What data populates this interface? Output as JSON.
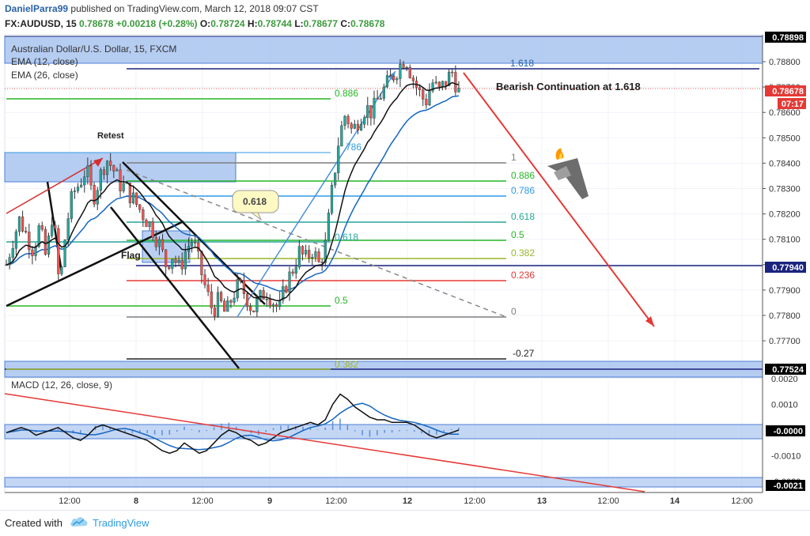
{
  "header": {
    "author": "DanielParra99",
    "published": " published on TradingView.com, March 12, 2018 09:07 CST",
    "symbol": "FX:AUDUSD, 15 ",
    "last": "0.78678",
    "change": "+0.00218 (+0.28%)",
    "ohlc": {
      "o_label": "O:",
      "o": "0.78724",
      "h_label": "H:",
      "h": "0.78744",
      "l_label": "L:",
      "l": "0.78677",
      "c_label": "C:",
      "c": "0.78678"
    }
  },
  "legend": {
    "title": "Australian Dollar/U.S. Dollar, 15, FXCM",
    "ema12": "EMA (12, close)",
    "ema26": "EMA (26, close)",
    "macd": "MACD (12, 26, close, 9)"
  },
  "annotations": {
    "retest": "Retest",
    "flag": "Flag",
    "bearish": "Bearish Continuation at 1.618",
    "bubble": "0.618",
    "fib_upper_1618": "1.618",
    "fib_upper_0886": "0.886",
    "fib_upper_786": "786",
    "fib_upper_0618": "0.618",
    "fib_upper_05": "0.5",
    "fib_upper_0382": "0.382",
    "fib_right": [
      {
        "label": "1",
        "color": "#7f7f7f"
      },
      {
        "label": "0.886",
        "color": "#26b526"
      },
      {
        "label": "0.786",
        "color": "#2e9be6"
      },
      {
        "label": "0.618",
        "color": "#26a69a"
      },
      {
        "label": "0.5",
        "color": "#26b526"
      },
      {
        "label": "0.382",
        "color": "#9bb52a"
      },
      {
        "label": "0.236",
        "color": "#e53935"
      },
      {
        "label": "0",
        "color": "#7f7f7f"
      },
      {
        "label": "-0.27",
        "color": "#222222"
      }
    ]
  },
  "axis": {
    "price_ticks": [
      "0.78800",
      "0.78700",
      "0.78600",
      "0.78500",
      "0.78400",
      "0.78300",
      "0.78200",
      "0.78100",
      "0.78000",
      "0.77900",
      "0.77800",
      "0.77700",
      "0.77600"
    ],
    "macd_ticks": [
      "0.0020",
      "0.0010",
      "0.0000",
      "-0.0010",
      "-0.0020"
    ],
    "time_ticks": [
      "12:00",
      "8",
      "12:00",
      "9",
      "12:00",
      "12",
      "12:00",
      "13",
      "12:00",
      "14",
      "12:00"
    ],
    "price_badges": [
      {
        "text": "0.78898",
        "bg": "#000000",
        "fg": "#ffffff"
      },
      {
        "text": "0.78678",
        "bg": "#e53935",
        "fg": "#ffffff"
      },
      {
        "text": "07:17",
        "bg": "#e53935",
        "fg": "#ffffff"
      },
      {
        "text": "0.77940",
        "bg": "#1a237e",
        "fg": "#ffffff"
      },
      {
        "text": "0.77524",
        "bg": "#000000",
        "fg": "#ffffff"
      }
    ],
    "macd_badges": [
      {
        "text": "-0.0000",
        "bg": "#000000",
        "fg": "#ffffff"
      },
      {
        "text": "-0.0021",
        "bg": "#000000",
        "fg": "#ffffff"
      }
    ]
  },
  "colors": {
    "accent_blue": "#2962ff",
    "band": "#a9c4f0",
    "bull": "#26a69a",
    "bear": "#ef5350",
    "arrow": "#e53935"
  },
  "footer": {
    "created": "Created with",
    "brand": "TradingView"
  },
  "chart_data": {
    "type": "candlestick",
    "symbol": "FX:AUDUSD",
    "interval": "15",
    "ylim": [
      0.7752,
      0.7891
    ],
    "x_ticks": [
      "12:00",
      "8",
      "12:00",
      "9",
      "12:00",
      "12",
      "12:00",
      "13",
      "12:00",
      "14",
      "12:00"
    ],
    "close_path": [
      0.78,
      0.781,
      0.7818,
      0.7812,
      0.7806,
      0.7815,
      0.7802,
      0.7822,
      0.779,
      0.7815,
      0.7828,
      0.7832,
      0.7838,
      0.7826,
      0.7834,
      0.7842,
      0.7838,
      0.7832,
      0.783,
      0.7826,
      0.7822,
      0.7818,
      0.7814,
      0.7808,
      0.78,
      0.7804,
      0.7798,
      0.7806,
      0.781,
      0.78,
      0.779,
      0.7782,
      0.7786,
      0.778,
      0.7788,
      0.7792,
      0.7788,
      0.7782,
      0.7786,
      0.779,
      0.7786,
      0.7782,
      0.7792,
      0.7798,
      0.7805,
      0.7802,
      0.7806,
      0.78,
      0.7808,
      0.783,
      0.785,
      0.786,
      0.7852,
      0.7858,
      0.7862,
      0.786,
      0.7866,
      0.787,
      0.7874,
      0.7878,
      0.7882,
      0.7874,
      0.7868,
      0.7864,
      0.7872,
      0.7868,
      0.7872,
      0.7876,
      0.7868
    ],
    "ema12": "EMA (12, close)",
    "ema26": "EMA (26, close)",
    "last_price": 0.78678,
    "range_marks": [
      0.78898,
      0.7794,
      0.77524
    ],
    "fibonacci_right": [
      {
        "level": "1",
        "price": 0.78373
      },
      {
        "level": "0.886",
        "price": 0.78295
      },
      {
        "level": "0.786",
        "price": 0.78232
      },
      {
        "level": "0.618",
        "price": 0.78122
      },
      {
        "level": "0.5",
        "price": 0.78046
      },
      {
        "level": "0.382",
        "price": 0.7797
      },
      {
        "level": "0.236",
        "price": 0.77877
      },
      {
        "level": "0",
        "price": 0.77724
      },
      {
        "level": "-0.27",
        "price": 0.77551
      }
    ],
    "fibonacci_upper": [
      {
        "level": "1.618",
        "price": 0.7879
      },
      {
        "level": "0.886",
        "price": 0.78679
      },
      {
        "level": "786",
        "price": 0.7847
      },
      {
        "level": "0.618",
        "price": 0.7804
      },
      {
        "level": "0.5",
        "price": 0.7778
      }
    ],
    "macd": {
      "label": "MACD (12, 26, close, 9)",
      "ylim": [
        -0.0022,
        0.0023
      ],
      "ticks": [
        0.002,
        0.001,
        0.0,
        -0.001,
        -0.002
      ],
      "last": -0.0,
      "lower_mark": -0.0021,
      "macd_path": [
        -0.0001,
        0.0,
        0.0001,
        0.0,
        -0.0002,
        -0.0001,
        0.0,
        0.0001,
        -0.0001,
        -0.0003,
        -0.0004,
        -0.0002,
        0.0001,
        0.0002,
        0.0001,
        0.0,
        -0.0001,
        -0.0002,
        -0.0003,
        -0.0004,
        -0.0006,
        -0.0008,
        -0.0009,
        -0.0008,
        -0.0005,
        -0.0007,
        -0.0009,
        -0.0008,
        -0.0005,
        -0.0002,
        0.0,
        -0.0001,
        -0.0003,
        -0.0004,
        -0.0006,
        -0.0005,
        -0.0003,
        -0.0001,
        0.0,
        0.0001,
        0.0002,
        0.0003,
        0.0002,
        0.0004,
        0.001,
        0.0014,
        0.0012,
        0.0009,
        0.0007,
        0.0005,
        0.0004,
        0.0004,
        0.0003,
        0.0003,
        0.0003,
        0.0002,
        0.0,
        -0.0002,
        -0.0003,
        -0.0002,
        -0.0001,
        0.0
      ]
    },
    "annotations": [
      "Retest",
      "Flag",
      "Bearish Continuation at 1.618",
      "0.618"
    ]
  }
}
